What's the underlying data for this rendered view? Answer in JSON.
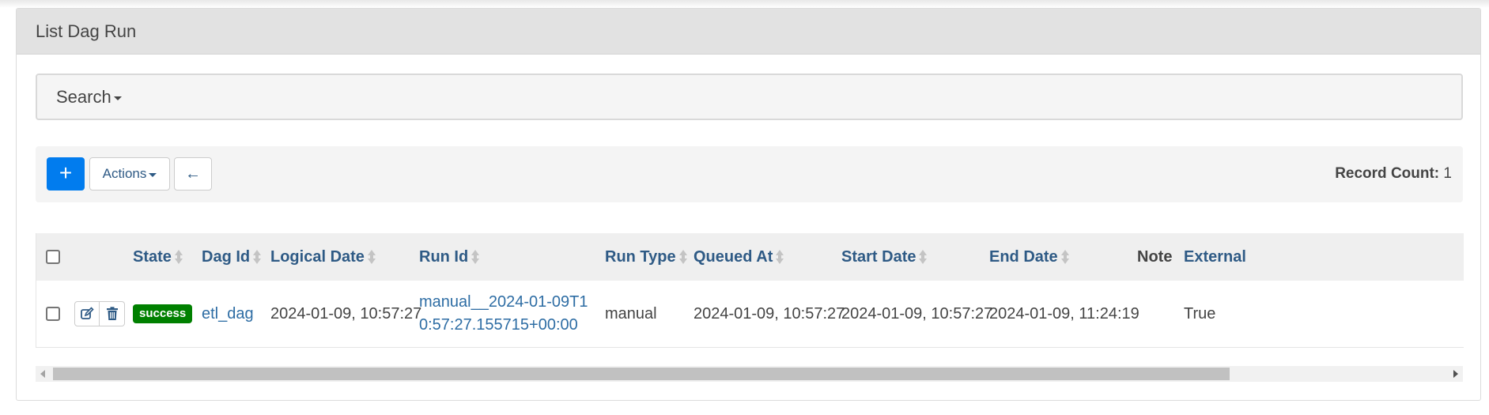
{
  "panel": {
    "title": "List Dag Run"
  },
  "search": {
    "label": "Search"
  },
  "toolbar": {
    "add_label": "+",
    "actions_label": "Actions",
    "back_label": "←",
    "record_count_label": "Record Count:",
    "record_count_value": "1"
  },
  "table": {
    "columns": [
      "State",
      "Dag Id",
      "Logical Date",
      "Run Id",
      "Run Type",
      "Queued At",
      "Start Date",
      "End Date",
      "Note",
      "External"
    ],
    "rows": [
      {
        "state": "success",
        "dag_id": "etl_dag",
        "logical_date": "2024-01-09, 10:57:27",
        "run_id": "manual__2024-01-09T10:57:27.155715+00:00",
        "run_type": "manual",
        "queued_at": "2024-01-09, 10:57:27",
        "start_date": "2024-01-09, 10:57:27",
        "end_date": "2024-01-09, 11:24:19",
        "note": "",
        "external": "True"
      }
    ]
  },
  "colors": {
    "primary": "#017cee",
    "success": "#008000",
    "link": "#2e5a85"
  },
  "icons": [
    "plus-icon",
    "arrow-left-icon",
    "edit-icon",
    "trash-icon",
    "sort-icon"
  ]
}
